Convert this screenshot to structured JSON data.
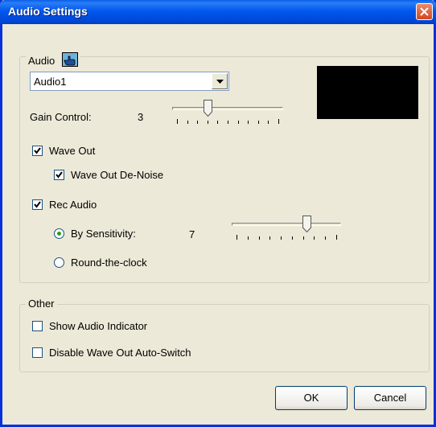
{
  "window": {
    "title": "Audio Settings"
  },
  "audio_group": {
    "legend": "Audio",
    "device_select": {
      "value": "Audio1"
    },
    "gain_control": {
      "label": "Gain Control:",
      "value_text": "3",
      "level": 0.3
    },
    "wave_out": {
      "label": "Wave Out",
      "checked": true
    },
    "wave_out_denoise": {
      "label": "Wave Out De-Noise",
      "checked": true
    },
    "rec_audio": {
      "label": "Rec Audio",
      "checked": true
    },
    "by_sensitivity": {
      "label": "By Sensitivity:",
      "value_text": "7",
      "selected": true,
      "level": 0.7
    },
    "round_the_clock": {
      "label": "Round-the-clock",
      "selected": false
    }
  },
  "other_group": {
    "legend": "Other",
    "show_audio_indicator": {
      "label": "Show Audio Indicator",
      "checked": false
    },
    "disable_wave_out_auto_switch": {
      "label": "Disable Wave Out Auto-Switch",
      "checked": false
    }
  },
  "buttons": {
    "ok": "OK",
    "cancel": "Cancel"
  },
  "icons": {
    "audio_group_icon": "hand-pointer-icon",
    "close": "close-icon",
    "dropdown": "chevron-down-icon"
  },
  "colors": {
    "title_bar": "#0054e3",
    "dialog_bg": "#ece9d8",
    "close_button": "#d6451f",
    "preview": "#000000"
  }
}
